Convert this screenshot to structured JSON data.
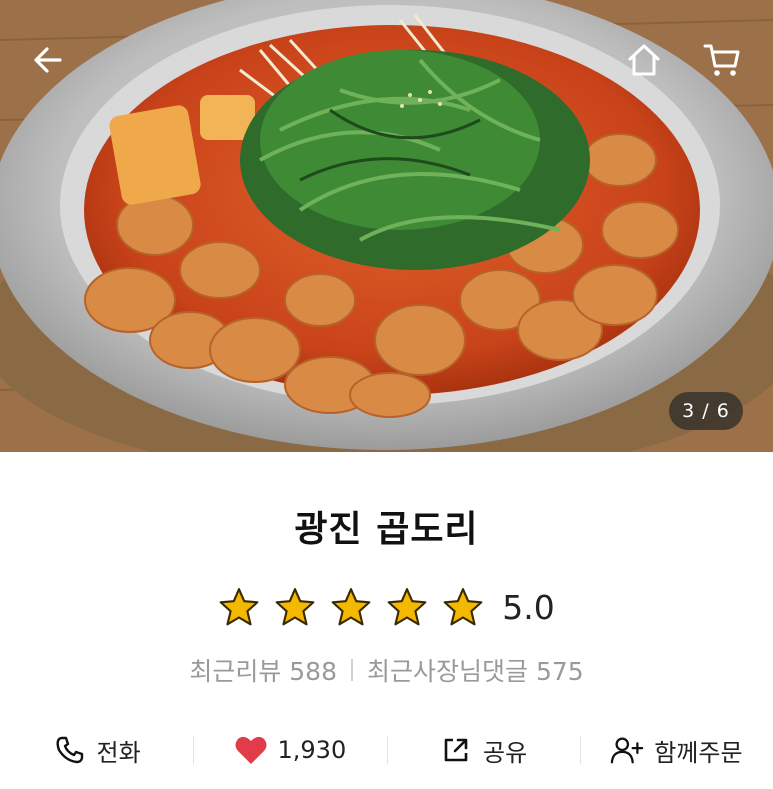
{
  "header": {
    "back_icon": "arrow-left-icon",
    "home_icon": "home-icon",
    "cart_icon": "cart-icon"
  },
  "gallery": {
    "counter": "3 / 6"
  },
  "store": {
    "name": "광진 곱도리",
    "rating": {
      "stars_filled": 5,
      "stars_total": 5,
      "value": "5.0",
      "star_color": "#f5b800"
    },
    "reviews": {
      "recent_reviews": "최근리뷰 588",
      "owner_replies": "최근사장님댓글 575"
    }
  },
  "actions": [
    {
      "icon": "phone-icon",
      "label": "전화"
    },
    {
      "icon": "heart-icon",
      "label": "1,930",
      "color": "#e23c4b"
    },
    {
      "icon": "share-icon",
      "label": "공유"
    },
    {
      "icon": "add-user-icon",
      "label": "함께주문"
    }
  ]
}
